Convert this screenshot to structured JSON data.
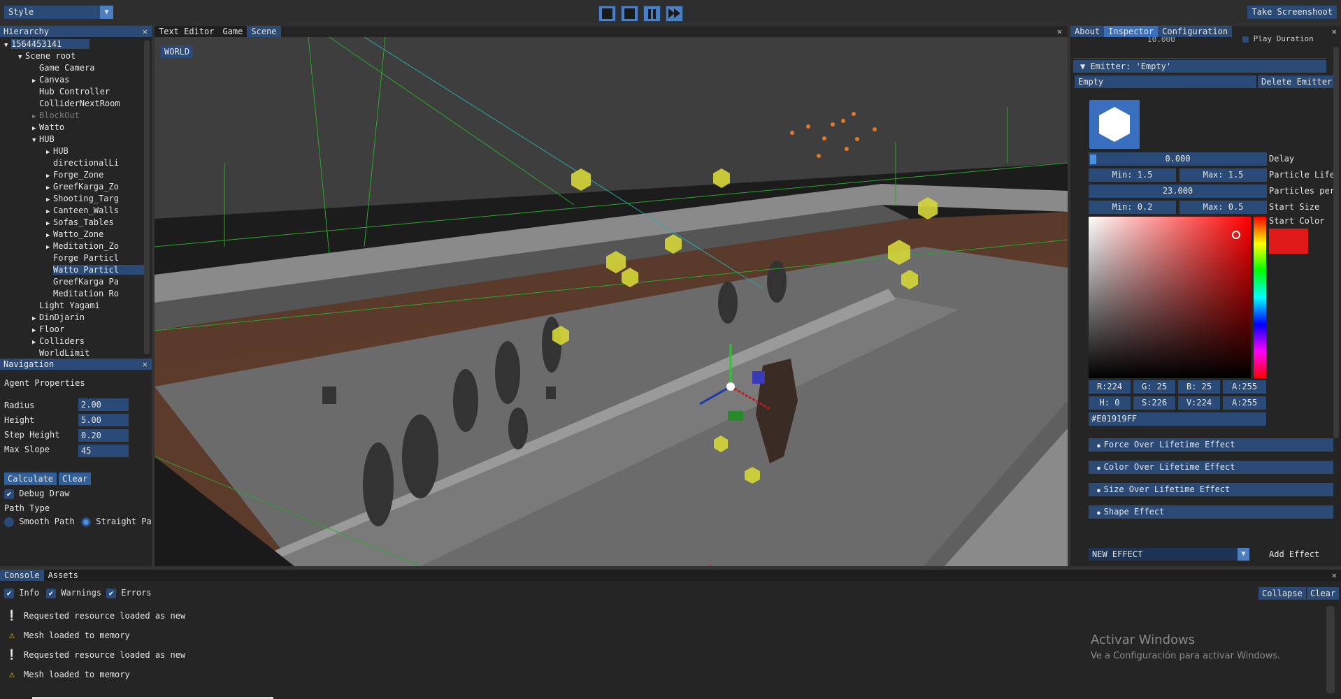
{
  "topbar": {
    "style_combo": "Style",
    "screenshot_button": "Take Screenshoot"
  },
  "hierarchy": {
    "title": "Hierarchy",
    "items": [
      {
        "label": "1564453141",
        "indent": 0,
        "arrow": "▼",
        "selected": true
      },
      {
        "label": "Scene root",
        "indent": 1,
        "arrow": "▼"
      },
      {
        "label": "Game Camera",
        "indent": 2,
        "arrow": ""
      },
      {
        "label": "Canvas",
        "indent": 2,
        "arrow": "▶"
      },
      {
        "label": "Hub Controller",
        "indent": 2,
        "arrow": ""
      },
      {
        "label": "ColliderNextRoom",
        "indent": 2,
        "arrow": ""
      },
      {
        "label": "BlockOut",
        "indent": 2,
        "arrow": "▶",
        "dim": true
      },
      {
        "label": "Watto",
        "indent": 2,
        "arrow": "▶"
      },
      {
        "label": "HUB",
        "indent": 2,
        "arrow": "▼"
      },
      {
        "label": "HUB",
        "indent": 3,
        "arrow": "▶"
      },
      {
        "label": "directionalLi",
        "indent": 3,
        "arrow": ""
      },
      {
        "label": "Forge_Zone",
        "indent": 3,
        "arrow": "▶"
      },
      {
        "label": "GreefKarga_Zo",
        "indent": 3,
        "arrow": "▶"
      },
      {
        "label": "Shooting_Targ",
        "indent": 3,
        "arrow": "▶"
      },
      {
        "label": "Canteen_Walls",
        "indent": 3,
        "arrow": "▶"
      },
      {
        "label": "Sofas_Tables",
        "indent": 3,
        "arrow": "▶"
      },
      {
        "label": "Watto_Zone",
        "indent": 3,
        "arrow": "▶"
      },
      {
        "label": "Meditation_Zo",
        "indent": 3,
        "arrow": "▶"
      },
      {
        "label": "Forge Particl",
        "indent": 3,
        "arrow": ""
      },
      {
        "label": "Watto Particl",
        "indent": 3,
        "arrow": "",
        "selected": true
      },
      {
        "label": "GreefKarga Pa",
        "indent": 3,
        "arrow": ""
      },
      {
        "label": "Meditation Ro",
        "indent": 3,
        "arrow": ""
      },
      {
        "label": "Light Yagami",
        "indent": 2,
        "arrow": ""
      },
      {
        "label": "DinDjarin",
        "indent": 2,
        "arrow": "▶"
      },
      {
        "label": "Floor",
        "indent": 2,
        "arrow": "▶"
      },
      {
        "label": "Colliders",
        "indent": 2,
        "arrow": "▶"
      },
      {
        "label": "WorldLimit",
        "indent": 2,
        "arrow": ""
      }
    ]
  },
  "navigation": {
    "title": "Navigation",
    "agent_header": "Agent Properties",
    "radius_label": "Radius",
    "radius": "2.00",
    "height_label": "Height",
    "height": "5.00",
    "step_label": "Step Height",
    "step": "0.20",
    "slope_label": "Max Slope",
    "slope": "45",
    "calculate": "Calculate",
    "clear": "Clear",
    "debug_draw": "Debug Draw",
    "path_type": "Path Type",
    "smooth": "Smooth Path",
    "straight": "Straight Pa"
  },
  "viewport": {
    "tabs": [
      "Text Editor",
      "Game",
      "Scene"
    ],
    "world_button": "WORLD"
  },
  "inspector": {
    "tabs": [
      "About",
      "Inspector",
      "Configuration"
    ],
    "top_value": "10.000",
    "play_duration": "Play Duration",
    "emitter_header": "Emitter: 'Empty'",
    "emitter_name": "Empty",
    "delete_emitter": "Delete Emitter",
    "delay_value": "0.000",
    "delay_label": "Delay",
    "life_min": "Min: 1.5",
    "life_max": "Max: 1.5",
    "life_label": "Particle Life",
    "per_value": "23.000",
    "per_label": "Particles per",
    "size_min": "Min: 0.2",
    "size_max": "Max: 0.5",
    "size_label": "Start Size",
    "color_label": "Start Color",
    "r": "R:224",
    "g": "G: 25",
    "b": "B: 25",
    "a": "A:255",
    "h": "H:  0",
    "s": "S:226",
    "v": "V:224",
    "a2": "A:255",
    "hex": "#E01919FF",
    "start_color": "#E01919",
    "effects": [
      "Force Over Lifetime Effect",
      "Color Over Lifetime Effect",
      "Size Over Lifetime Effect",
      "Shape Effect"
    ],
    "new_effect": "NEW EFFECT",
    "add_effect": "Add Effect"
  },
  "console": {
    "tabs": [
      "Console",
      "Assets"
    ],
    "filters": [
      "Info",
      "Warnings",
      "Errors"
    ],
    "collapse": "Collapse",
    "clear": "Clear",
    "lines": [
      {
        "icon": "info-icon",
        "text": "Requested resource loaded as new"
      },
      {
        "icon": "warning-icon",
        "text": "Mesh loaded to memory"
      },
      {
        "icon": "info-icon",
        "text": "Requested resource loaded as new"
      },
      {
        "icon": "warning-icon",
        "text": "Mesh loaded to memory"
      }
    ],
    "watermark_title": "Activar Windows",
    "watermark_sub": "Ve a Configuración para activar Windows."
  }
}
